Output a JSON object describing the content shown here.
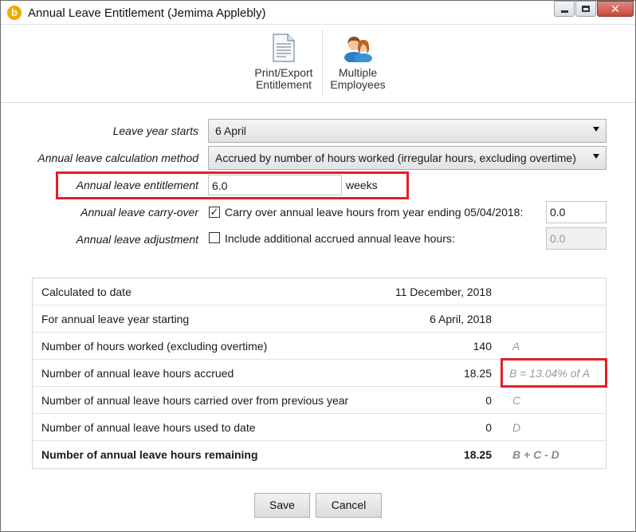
{
  "window": {
    "title": "Annual Leave Entitlement (Jemima Applebly)",
    "app_icon_glyph": "b"
  },
  "toolbar": {
    "print_label_line1": "Print/Export",
    "print_label_line2": "Entitlement",
    "multi_label_line1": "Multiple",
    "multi_label_line2": "Employees"
  },
  "form": {
    "leave_year_starts_label": "Leave year starts",
    "leave_year_starts_value": "6 April",
    "calc_method_label": "Annual leave calculation method",
    "calc_method_value": "Accrued by number of hours worked (irregular hours, excluding overtime)",
    "entitlement_label": "Annual leave entitlement",
    "entitlement_value": "6.0",
    "entitlement_unit": "weeks",
    "carryover_label": "Annual leave carry-over",
    "carryover_checked": true,
    "carryover_text": "Carry over annual leave hours from year ending 05/04/2018:",
    "carryover_value": "0.0",
    "adjustment_label": "Annual leave adjustment",
    "adjustment_checked": false,
    "adjustment_text": "Include additional accrued annual leave hours:",
    "adjustment_value": "0.0"
  },
  "summary": {
    "rows": [
      {
        "label": "Calculated to date",
        "value": "11 December, 2018",
        "note": ""
      },
      {
        "label": "For annual leave year starting",
        "value": "6 April, 2018",
        "note": ""
      },
      {
        "label": "Number of hours worked (excluding overtime)",
        "value": "140",
        "note": "A"
      },
      {
        "label": "Number of annual leave hours accrued",
        "value": "18.25",
        "note": "B = 13.04% of A"
      },
      {
        "label": "Number of annual leave hours carried over from previous year",
        "value": "0",
        "note": "C"
      },
      {
        "label": "Number of annual leave hours used to date",
        "value": "0",
        "note": "D"
      },
      {
        "label": "Number of annual leave hours remaining",
        "value": "18.25",
        "note": "B + C - D"
      }
    ]
  },
  "buttons": {
    "save": "Save",
    "cancel": "Cancel"
  },
  "colors": {
    "highlight": "#e0202a",
    "app_icon": "#f2a900"
  }
}
